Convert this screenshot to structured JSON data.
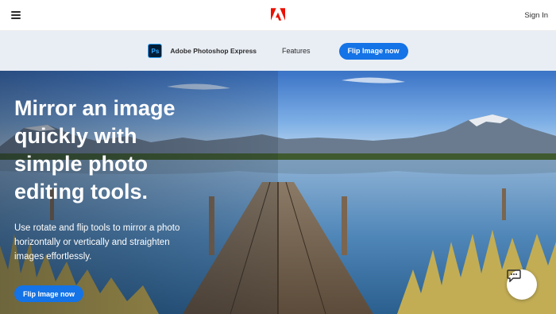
{
  "gnav": {
    "menu_icon": "hamburger-icon",
    "logo": "adobe-logo",
    "signin_label": "Sign In"
  },
  "localnav": {
    "product_icon": "ps",
    "product_name": "Adobe Photoshop Express",
    "features_label": "Features",
    "cta_label": "Flip Image now"
  },
  "hero": {
    "title": "Mirror an image quickly with simple photo editing tools.",
    "body": "Use rotate and flip tools to mirror a photo horizontally or vertically and straighten images effortlessly.",
    "cta_label": "Flip Image now",
    "chat_icon": "chat-bubble-icon"
  },
  "colors": {
    "accent": "#1473e6",
    "adobe_red": "#eb1000",
    "localnav_bg": "#e9eef5"
  }
}
